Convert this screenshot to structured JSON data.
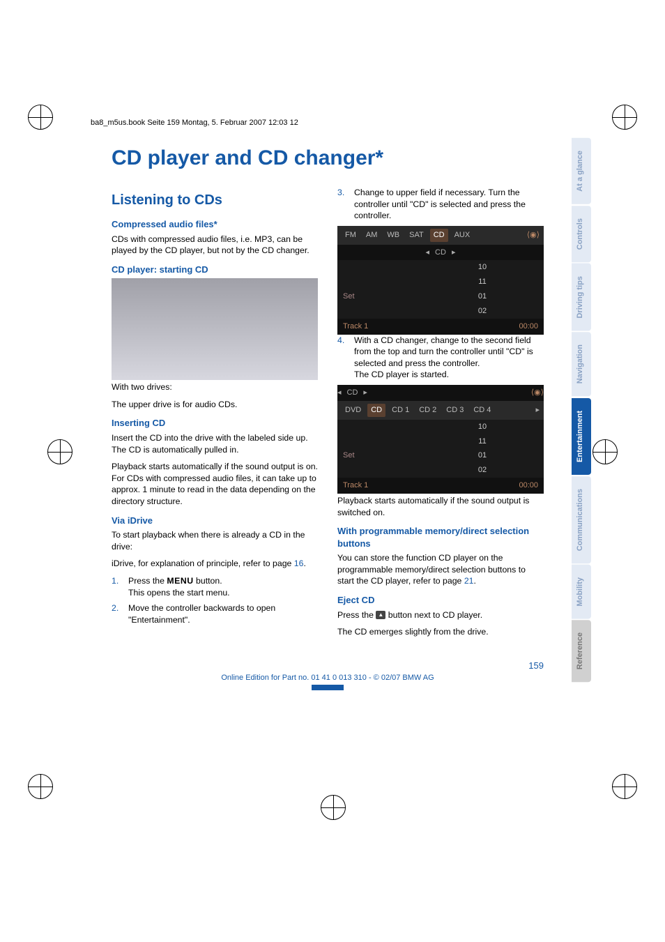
{
  "meta": {
    "running_header": "ba8_m5us.book  Seite 159  Montag, 5. Februar 2007  12:03 12"
  },
  "title": "CD player and CD changer*",
  "side_tabs": [
    "At a glance",
    "Controls",
    "Driving tips",
    "Navigation",
    "Entertainment",
    "Communications",
    "Mobility",
    "Reference"
  ],
  "left": {
    "h2": "Listening to CDs",
    "compressed_h": "Compressed audio files*",
    "compressed_p": "CDs with compressed audio files, i.e. MP3, can be played by the CD player, but not by the CD changer.",
    "start_h": "CD player: starting CD",
    "twodrives1": "With two drives:",
    "twodrives2": "The upper drive is for audio CDs.",
    "insert_h": "Inserting CD",
    "insert_p1": "Insert the CD into the drive with the labeled side up. The CD is automatically pulled in.",
    "insert_p2": "Playback starts automatically if the sound output is on. For CDs with compressed audio files, it can take up to approx. 1 minute to read in the data depending on the directory structure.",
    "via_h": "Via iDrive",
    "via_p1": "To start playback when there is already a CD in the drive:",
    "via_p2a": "iDrive, for explanation of principle, refer to page ",
    "via_p2_ref": "16",
    "via_p2b": ".",
    "steps": [
      {
        "n": "1.",
        "a": "Press the ",
        "chip": "MENU",
        "b": " button.",
        "c": "This opens the start menu."
      },
      {
        "n": "2.",
        "a": "Move the controller backwards to open \"Entertainment\"."
      }
    ]
  },
  "right": {
    "step3": {
      "n": "3.",
      "text": "Change to upper field if necessary. Turn the controller until \"CD\" is selected and press the controller."
    },
    "screen1": {
      "tabs": [
        "FM",
        "AM",
        "WB",
        "SAT",
        "CD",
        "AUX"
      ],
      "active_tab": "CD",
      "top_label": "CD",
      "rows": [
        {
          "l": "",
          "v": "10"
        },
        {
          "l": "",
          "v": "11"
        },
        {
          "l": "Set",
          "v": "01"
        },
        {
          "l": "",
          "v": "02"
        }
      ],
      "footer_l": "Track 1",
      "footer_r": "00:00"
    },
    "step4": {
      "n": "4.",
      "a": "With a CD changer, change to the second field from the top and turn the controller until \"CD\" is selected and press the controller.",
      "b": "The CD player is started."
    },
    "screen2": {
      "top_label": "CD",
      "tabs": [
        "DVD",
        "CD",
        "CD 1",
        "CD 2",
        "CD 3",
        "CD 4"
      ],
      "active_tab": "CD",
      "rows": [
        {
          "l": "",
          "v": "10"
        },
        {
          "l": "",
          "v": "11"
        },
        {
          "l": "Set",
          "v": "01"
        },
        {
          "l": "",
          "v": "02"
        }
      ],
      "footer_l": "Track 1",
      "footer_r": "00:00"
    },
    "after_p": "Playback starts automatically if the sound output is switched on.",
    "prog_h": "With programmable memory/direct selection buttons",
    "prog_p_a": "You can store the function CD player on the programmable memory/direct selection buttons to start the CD player, refer to page ",
    "prog_ref": "21",
    "prog_p_b": ".",
    "eject_h": "Eject CD",
    "eject_p1a": "Press the ",
    "eject_p1b": " button next to CD player.",
    "eject_p2": "The CD emerges slightly from the drive."
  },
  "footer": {
    "page": "159",
    "line": "Online Edition for Part no. 01 41 0 013 310 - © 02/07 BMW AG"
  }
}
